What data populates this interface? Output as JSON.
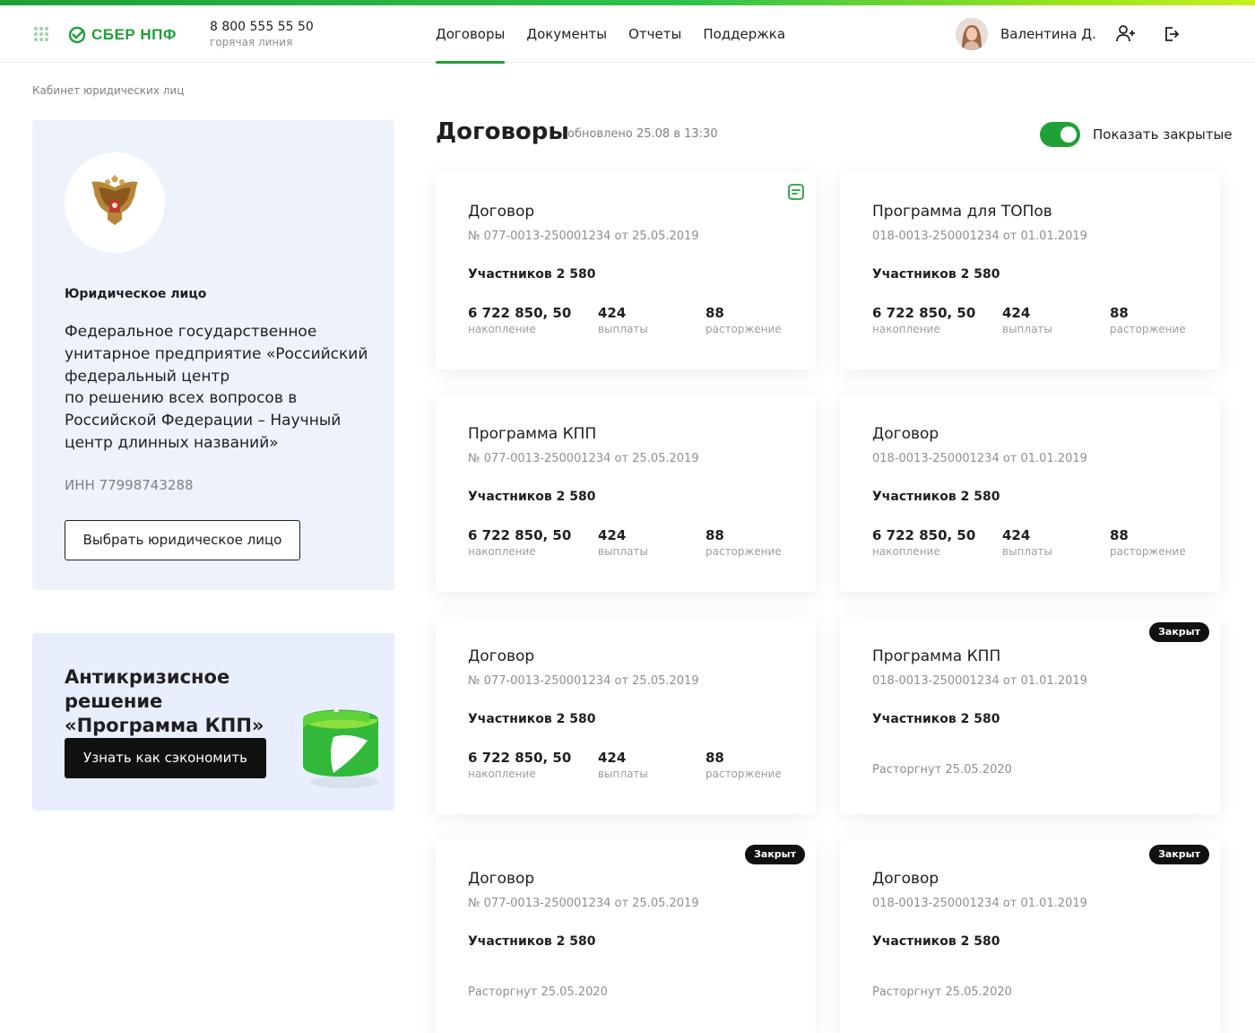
{
  "header": {
    "logo_text": "СБЕР НПФ",
    "hotline_phone": "8 800 555 55 50",
    "hotline_label": "горячая линия",
    "nav": [
      {
        "label": "Договоры",
        "active": true
      },
      {
        "label": "Документы",
        "active": false
      },
      {
        "label": "Отчеты",
        "active": false
      },
      {
        "label": "Поддержка",
        "active": false
      }
    ],
    "user_name": "Валентина Д."
  },
  "breadcrumb": "Кабинет юридических лиц",
  "entity": {
    "label": "Юридическое лицо",
    "name": "Федеральное государственное\nунитарное предприятие «Российский\nфедеральный центр\nпо решению всех вопросов в\nРоссийской Федерации – Научный\nцентр длинных названий»",
    "inn": "ИНН 77998743288",
    "select_button": "Выбрать юридическое лицо"
  },
  "promo": {
    "title": "Антикризисное решение\n«Программа КПП»",
    "button": "Узнать как сэкономить"
  },
  "contracts_section": {
    "title": "Договоры",
    "updated": "обновлено 25.08 в 13:30",
    "show_closed_label": "Показать закрытые",
    "show_closed": true
  },
  "stat_labels": {
    "savings": "накопление",
    "payouts": "выплаты",
    "termination": "расторжение"
  },
  "cards": [
    {
      "title": "Договор",
      "number": "№ 077-0013-250001234 от 25.05.2019",
      "participants": "Участников 2 580",
      "savings": "6 722 850, 50",
      "payouts": "424",
      "termination": "88",
      "icon": "document-icon"
    },
    {
      "title": "Программа для ТОПов",
      "number": "018-0013-250001234 от 01.01.2019",
      "participants": "Участников 2 580",
      "savings": "6 722 850, 50",
      "payouts": "424",
      "termination": "88"
    },
    {
      "title": "Программа КПП",
      "number": "№ 077-0013-250001234 от 25.05.2019",
      "participants": "Участников 2 580",
      "savings": "6 722 850, 50",
      "payouts": "424",
      "termination": "88"
    },
    {
      "title": "Договор",
      "number": "018-0013-250001234 от 01.01.2019",
      "participants": "Участников 2 580",
      "savings": "6 722 850, 50",
      "payouts": "424",
      "termination": "88"
    },
    {
      "title": "Договор",
      "number": "№ 077-0013-250001234 от 25.05.2019",
      "participants": "Участников 2 580",
      "savings": "6 722 850, 50",
      "payouts": "424",
      "termination": "88"
    },
    {
      "title": "Программа КПП",
      "number": "018-0013-250001234 от 01.01.2019",
      "participants": "Участников 2 580",
      "badge": "Закрыт",
      "terminated": "Расторгнут 25.05.2020"
    },
    {
      "title": "Договор",
      "number": "№ 077-0013-250001234 от 25.05.2019",
      "participants": "Участников 2 580",
      "badge": "Закрыт",
      "terminated": "Расторгнут 25.05.2020"
    },
    {
      "title": "Договор",
      "number": "018-0013-250001234 от 01.01.2019",
      "participants": "Участников 2 580",
      "badge": "Закрыт",
      "terminated": "Расторгнут 25.05.2020"
    }
  ],
  "colors": {
    "brand_green": "#21a038",
    "panel_bg": "#eef3fb",
    "badge_bg": "#111111"
  }
}
